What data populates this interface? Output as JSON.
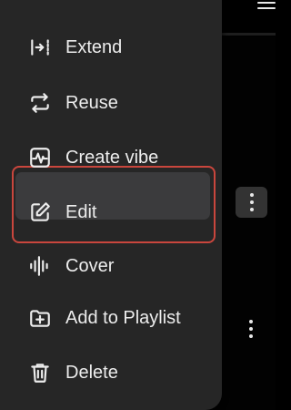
{
  "menu": {
    "items": [
      {
        "label": "Extend",
        "icon": "extend-icon"
      },
      {
        "label": "Reuse",
        "icon": "reuse-icon"
      },
      {
        "label": "Create vibe",
        "icon": "waveform-icon"
      },
      {
        "label": "Edit",
        "icon": "edit-icon",
        "state": "highlighted"
      },
      {
        "label": "Cover",
        "icon": "audio-bars-icon"
      },
      {
        "label": "Add to Playlist",
        "icon": "add-to-playlist-icon"
      },
      {
        "label": "Delete",
        "icon": "trash-icon"
      }
    ]
  },
  "colors": {
    "menu_background": "#262626",
    "highlight_background": "#3b3b3d",
    "outline": "#c9463d",
    "text": "#ececec"
  }
}
